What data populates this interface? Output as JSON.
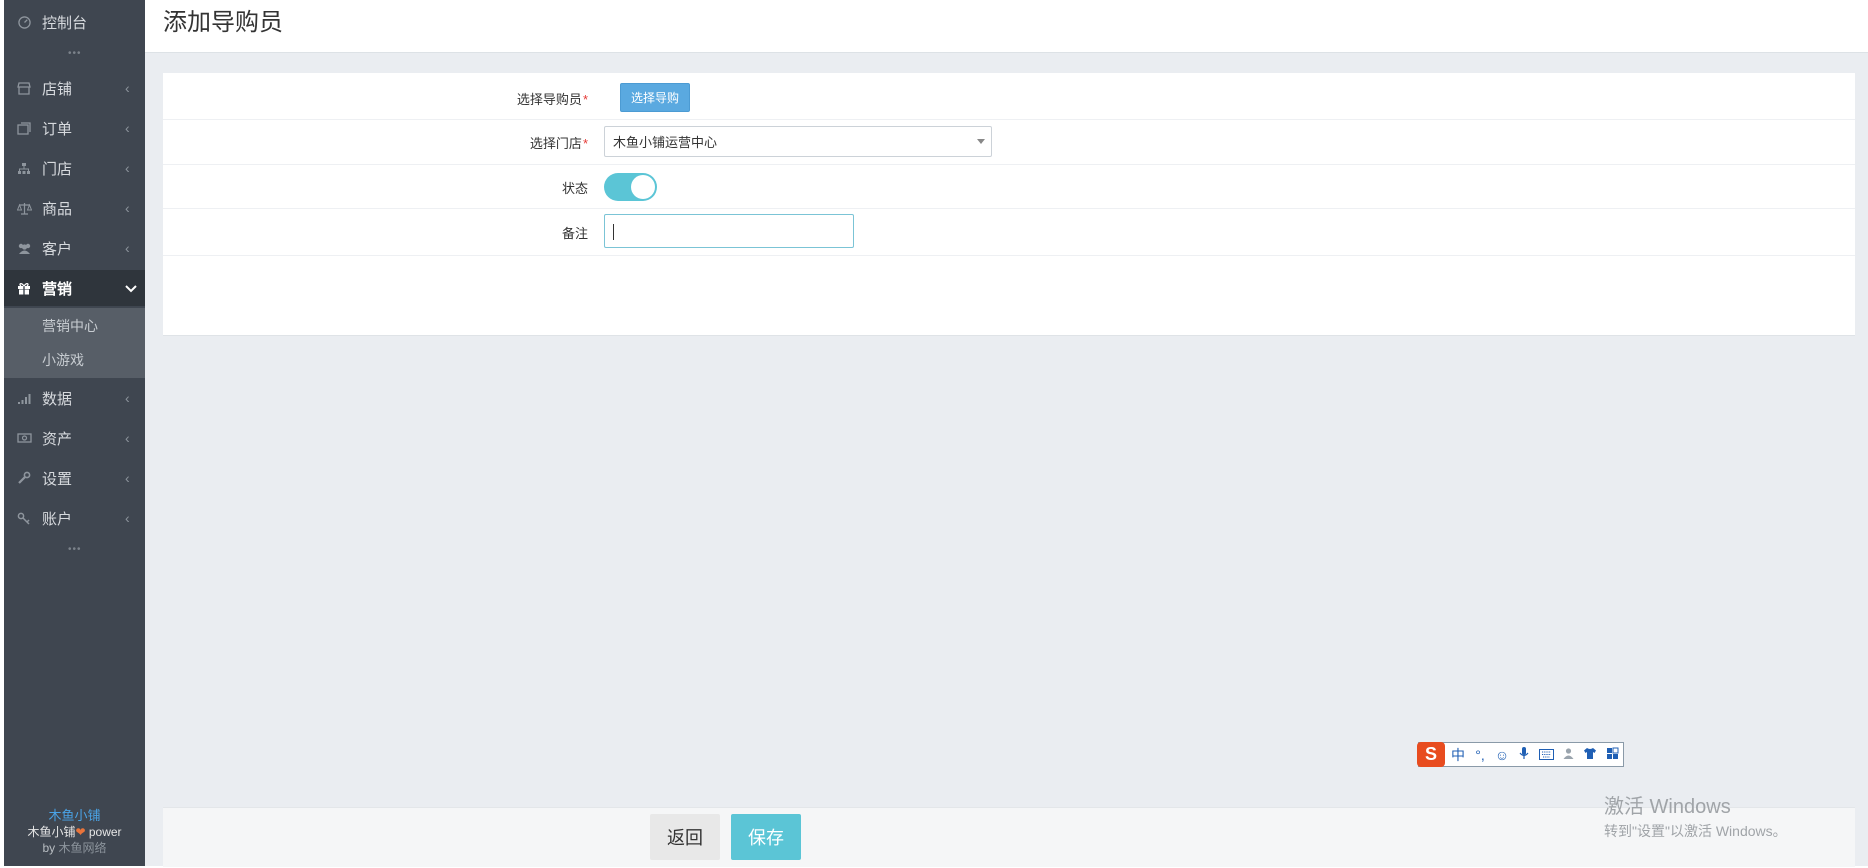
{
  "sidebar": {
    "items": [
      {
        "label": "控制台",
        "icon": "dashboard-icon",
        "has_chevron": false
      },
      {
        "label": "店铺",
        "icon": "shop-icon",
        "has_chevron": true
      },
      {
        "label": "订单",
        "icon": "order-icon",
        "has_chevron": true
      },
      {
        "label": "门店",
        "icon": "sitemap-icon",
        "has_chevron": true
      },
      {
        "label": "商品",
        "icon": "scale-icon",
        "has_chevron": true
      },
      {
        "label": "客户",
        "icon": "users-icon",
        "has_chevron": true
      },
      {
        "label": "营销",
        "icon": "gift-icon",
        "has_chevron": true,
        "active": true
      },
      {
        "label": "数据",
        "icon": "signal-icon",
        "has_chevron": true
      },
      {
        "label": "资产",
        "icon": "money-icon",
        "has_chevron": true
      },
      {
        "label": "设置",
        "icon": "wrench-icon",
        "has_chevron": true
      },
      {
        "label": "账户",
        "icon": "key-icon",
        "has_chevron": true
      }
    ],
    "sub_items": [
      "营销中心",
      "小游戏"
    ],
    "footer": {
      "brand": "木鱼小铺",
      "power_prefix": "木鱼小铺",
      "power_suffix": " power",
      "by_prefix": "by ",
      "by_name": "木鱼网络"
    }
  },
  "header": {
    "title": "添加导购员"
  },
  "form": {
    "guide_label": "选择导购员",
    "guide_button": "选择导购",
    "store_label": "选择门店",
    "store_value": "木鱼小铺运营中心",
    "status_label": "状态",
    "status_on": true,
    "remark_label": "备注",
    "remark_value": "",
    "required_mark": "*"
  },
  "actions": {
    "back": "返回",
    "save": "保存"
  },
  "ime": {
    "lang": "中",
    "punct": "°,"
  },
  "watermark": {
    "line1": "激活 Windows",
    "line2": "转到\"设置\"以激活 Windows。"
  },
  "colors": {
    "accent": "#5bc5d6",
    "primary_button": "#5aa9e0",
    "sidebar_bg": "#3f4650",
    "brand_link": "#4aa3e6"
  }
}
